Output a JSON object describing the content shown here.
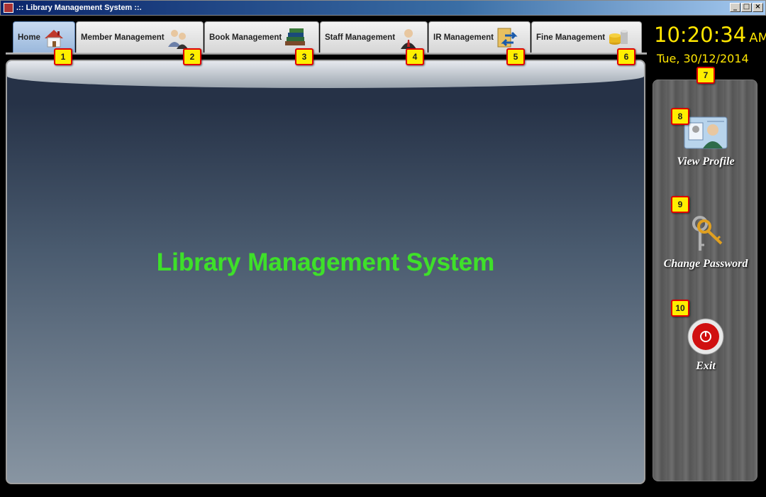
{
  "window": {
    "title": ".:: Library Management System ::.",
    "minimize": "_",
    "maximize": "□",
    "close": "×"
  },
  "tabs": [
    {
      "label": "Home",
      "icon": "home-icon",
      "active": true,
      "marker": "1"
    },
    {
      "label": "Member Management",
      "icon": "members-icon",
      "active": false,
      "marker": "2"
    },
    {
      "label": "Book Management",
      "icon": "books-icon",
      "active": false,
      "marker": "3"
    },
    {
      "label": "Staff Management",
      "icon": "staff-icon",
      "active": false,
      "marker": "4"
    },
    {
      "label": "IR Management",
      "icon": "ir-icon",
      "active": false,
      "marker": "5"
    },
    {
      "label": "Fine Management",
      "icon": "fine-icon",
      "active": false,
      "marker": "6"
    }
  ],
  "clock": {
    "time": "10:20:34",
    "ampm": "AM",
    "date": "Tue, 30/12/2014",
    "marker": "7"
  },
  "main": {
    "title": "Library Management System"
  },
  "side": {
    "view_profile": {
      "label": "View Profile",
      "marker": "8"
    },
    "change_password": {
      "label": "Change Password",
      "marker": "9"
    },
    "exit": {
      "label": "Exit",
      "marker": "10"
    }
  },
  "colors": {
    "clock": "#ffe600",
    "title_start": "#1ee81e",
    "title_end": "#c8e800",
    "marker_fill": "#ffef00",
    "marker_border": "#e00000"
  }
}
